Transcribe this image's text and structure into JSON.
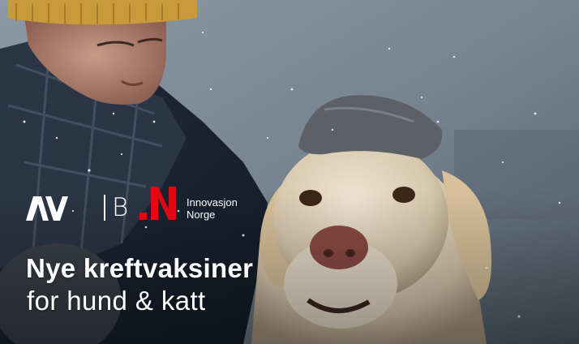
{
  "banner": {
    "headline": "Nye kreftvaksiner",
    "subheadline": "for hund & katt"
  },
  "logos": {
    "av": "AV",
    "b": "B",
    "innovasjon_line1": "Innovasjon",
    "innovasjon_line2": "Norge"
  },
  "colors": {
    "innovasjon_red": "#e30613",
    "text": "#ffffff"
  },
  "icons": [
    "av-logo-icon",
    "innovasjon-norge-logo-icon"
  ]
}
